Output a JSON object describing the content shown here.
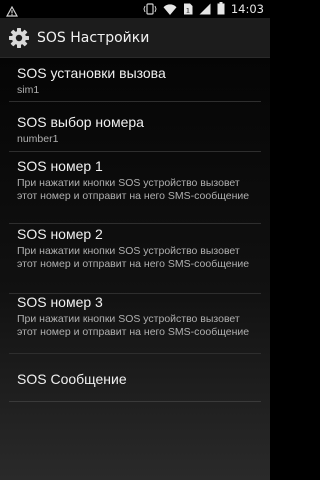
{
  "status_bar": {
    "time": "14:03",
    "icons": [
      "notification-icon",
      "vibrate-icon",
      "wifi-icon",
      "sim-icon",
      "signal-icon",
      "battery-icon"
    ]
  },
  "action_bar": {
    "title": "SOS Настройки",
    "icon": "gear-icon"
  },
  "settings": [
    {
      "title": "SOS установки вызова",
      "summary": "sim1"
    },
    {
      "title": "SOS выбор номера",
      "summary": "number1"
    },
    {
      "title": "SOS номер 1",
      "summary": "При нажатии кнопки SOS устройство вызовет этот номер и отправит на него SMS-сообщение"
    },
    {
      "title": "SOS номер 2",
      "summary": "При нажатии кнопки SOS устройство вызовет этот номер и отправит на него SMS-сообщение"
    },
    {
      "title": "SOS номер 3",
      "summary": "При нажатии кнопки SOS устройство вызовет этот номер и отправит на него SMS-сообщение"
    },
    {
      "title": "SOS Сообщение",
      "summary": ""
    }
  ]
}
